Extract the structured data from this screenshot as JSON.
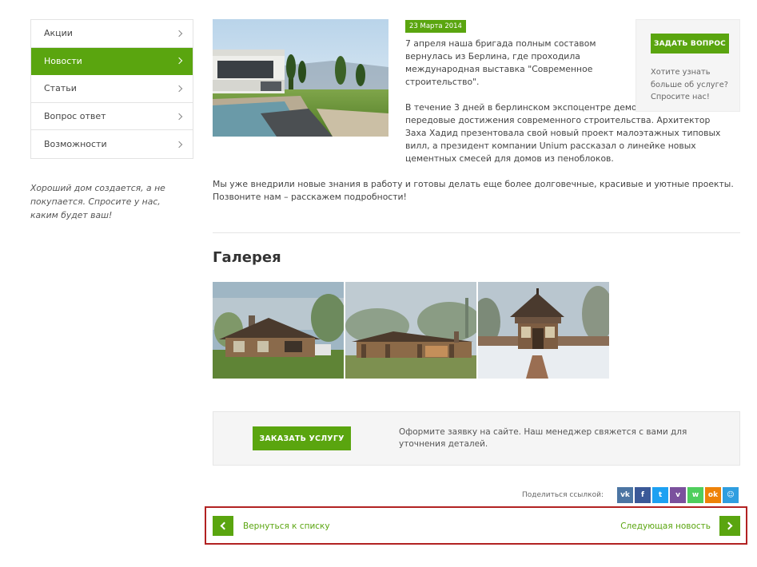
{
  "sidebar": {
    "items": [
      {
        "label": "Акции"
      },
      {
        "label": "Новости"
      },
      {
        "label": "Статьи"
      },
      {
        "label": "Вопрос ответ"
      },
      {
        "label": "Возможности"
      }
    ],
    "slogan": "Хороший дом создается, а не покупается. Спросите у нас, каким будет ваш!"
  },
  "article": {
    "date": "23 Марта 2014",
    "intro": "7 апреля наша бригада полным составом вернулась из Берлина, где проходила международная выставка \"Современное строительство\".",
    "paragraph2": "В течение 3 дней в берлинском экспоцентре демонстрировались передовые достижения современного строительства. Архитектор Заха Хадид презентовала свой новый проект малоэтажных типовых вилл, а президент компании Unium рассказал о линейке новых цементных смесей для домов из пеноблоков.",
    "paragraph3": "Мы уже внедрили новые знания в работу и готовы делать еще более долговечные, красивые и уютные проекты. Позвоните нам – расскажем подробности!"
  },
  "ask": {
    "button": "ЗАДАТЬ ВОПРОС",
    "text": "Хотите узнать больше об услуге? Спросите нас!"
  },
  "gallery": {
    "title": "Галерея"
  },
  "order": {
    "button": "ЗАКАЗАТЬ УСЛУГУ",
    "text": "Оформите заявку на сайте. Наш менеджер свяжется с вами для уточнения деталей."
  },
  "share": {
    "label": "Поделиться ссылкой:",
    "vk": "vk",
    "fb": "f",
    "tw": "t",
    "vb": "v",
    "wa": "w",
    "ok": "ok",
    "ya": "☺"
  },
  "nav": {
    "back": "Вернуться к списку",
    "next": "Следующая новость"
  },
  "colors": {
    "accent": "#5aa50f",
    "highlight": "#b22222"
  }
}
